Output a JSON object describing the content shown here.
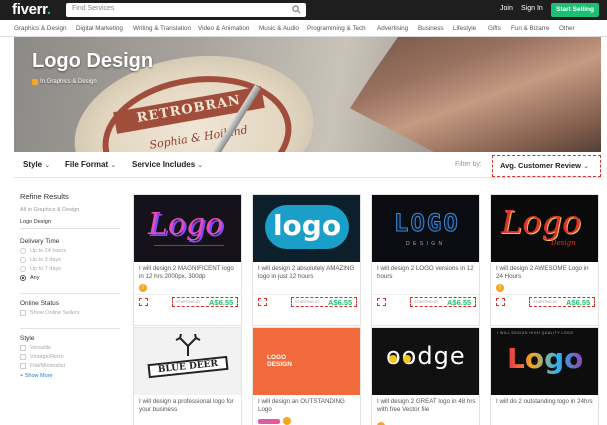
{
  "header": {
    "logo": "fiverr",
    "logo_dot": ".",
    "search_placeholder": "Find Services",
    "join": "Join",
    "sign_in": "Sign In",
    "start_selling": "Start Selling"
  },
  "categories": [
    "Graphics & Design",
    "Digital Marketing",
    "Writing & Translation",
    "Video & Animation",
    "Music & Audio",
    "Programming & Tech",
    "Advertising",
    "Business",
    "Lifestyle",
    "Gifts",
    "Fun & Bizarre",
    "Other"
  ],
  "banner": {
    "title": "Logo Design",
    "breadcrumb": "In Graphics & Design",
    "stamp_text": "RETROBRAN",
    "stamp_sub": "Sophia & Hoiland"
  },
  "filters": {
    "style": "Style",
    "file_format": "File Format",
    "service_includes": "Service Includes",
    "filter_by": "Filter by:",
    "sort_value": "Avg. Customer Review",
    "chevron": "⌄"
  },
  "sidebar": {
    "refine_title": "Refine Results",
    "all_in": "All in Graphics & Design",
    "selected": "Logo Design",
    "delivery_title": "Delivery Time",
    "delivery": [
      "Up to 24 hours",
      "Up to 3 days",
      "Up to 7 days",
      "Any"
    ],
    "online_title": "Online Status",
    "online_option": "Show Online Sellers",
    "style_title": "Style",
    "style_options": [
      "Versatile",
      "Vintage/Retro",
      "Flat/Minimalist"
    ],
    "show_more": "+ Show More"
  },
  "gigs": [
    {
      "title": "I will design 2 MAGNIFICENT logo in 12 hrs 2000px, 300dp",
      "starting": "STARTING AT",
      "price": "A$6.55",
      "art": "Logo"
    },
    {
      "title": "I will design 2 absolutely AMAZING logo in just 12 hours",
      "starting": "STARTING AT",
      "price": "A$6.55",
      "art": "logo"
    },
    {
      "title": "I will design 2 LOGO versions in 12 hours",
      "starting": "STARTING AT",
      "price": "A$6.55",
      "art": "LOGO",
      "art_sub": "D E S I G N"
    },
    {
      "title": "I will design 2 AWESOME Logo in 24 Hours",
      "starting": "STARTING AT",
      "price": "A$6.55",
      "art": "Logo",
      "art_sub": "Design"
    },
    {
      "title": "I will design a professional logo for your business",
      "art": "BLUE DEER"
    },
    {
      "title": "I will design an OUTSTANDING Logo",
      "art": "LOGO DESIGN"
    },
    {
      "title": "I will design 2 GREAT logo in 48 hrs with free Vector file",
      "art": "oodge"
    },
    {
      "title": "I will do 2 outstanding logo in 24hrs",
      "art": "Logo",
      "art_top": "I WILL DESIGN HIGH QUALITY LOGO"
    }
  ],
  "badge_level": "!",
  "heart_icon": "♡"
}
